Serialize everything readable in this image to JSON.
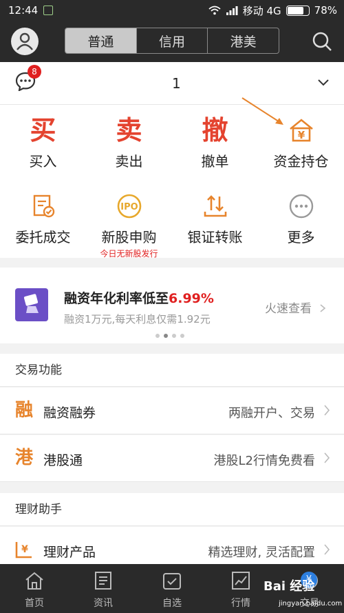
{
  "status_bar": {
    "time": "12:44",
    "carrier": "移动 4G",
    "battery": "78%",
    "battery_level": 0.78
  },
  "header": {
    "tabs": [
      {
        "label": "普通",
        "active": true
      },
      {
        "label": "信用",
        "active": false
      },
      {
        "label": "港美",
        "active": false
      }
    ]
  },
  "account": {
    "badge_count": "8",
    "account_text": "1"
  },
  "trade_actions": [
    {
      "glyph": "买",
      "label": "买入"
    },
    {
      "glyph": "卖",
      "label": "卖出"
    },
    {
      "glyph": "撤",
      "label": "撤单"
    },
    {
      "icon": "money-house-icon",
      "label": "资金持仓"
    }
  ],
  "secondary_actions": [
    {
      "icon": "order-check-icon",
      "label": "委托成交"
    },
    {
      "icon": "ipo-icon",
      "icon_text": "IPO",
      "label": "新股申购",
      "sub_label": "今日无新股发行"
    },
    {
      "icon": "transfer-icon",
      "label": "银证转账"
    },
    {
      "icon": "more-icon",
      "label": "更多"
    }
  ],
  "banner": {
    "title_prefix": "融资年化利率低至",
    "rate": "6.99%",
    "subtitle": "融资1万元,每天利息仅需1.92元",
    "link": "火速查看"
  },
  "trade_functions": {
    "header": "交易功能",
    "rows": [
      {
        "glyph": "融",
        "name": "融资融券",
        "value": "两融开户、交易"
      },
      {
        "glyph": "港",
        "name": "港股通",
        "value": "港股L2行情免费看"
      }
    ]
  },
  "wealth": {
    "header": "理财助手",
    "rows": [
      {
        "icon": "wealth-product-icon",
        "name": "理财产品",
        "value": "精选理财, 灵活配置"
      }
    ]
  },
  "bottom_nav": [
    {
      "icon": "home-icon",
      "label": "首页"
    },
    {
      "icon": "news-icon",
      "label": "资讯"
    },
    {
      "icon": "watchlist-icon",
      "label": "自选"
    },
    {
      "icon": "market-icon",
      "label": "行情"
    },
    {
      "icon": "trade-icon",
      "label": "交易"
    }
  ],
  "watermark": {
    "brand": "Bai 经验",
    "url": "jingyan.baidu.com",
    "badge": "¥"
  },
  "colors": {
    "accent_red": "#e4432f",
    "accent_orange": "#e7842c",
    "header_bg": "#2a2a2a"
  }
}
